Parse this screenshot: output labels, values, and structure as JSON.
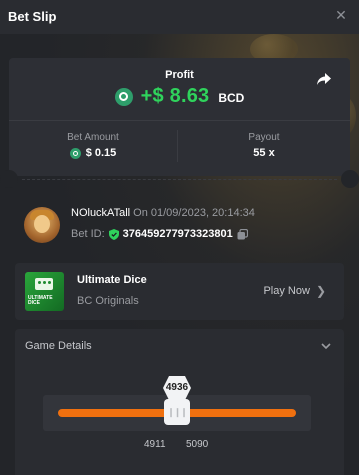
{
  "header": {
    "title": "Bet Slip",
    "close_icon": "close-icon"
  },
  "profit": {
    "label": "Profit",
    "value": "+$ 8.63",
    "currency": "BCD",
    "value_color": "#2fd35c"
  },
  "bet_amount": {
    "label": "Bet Amount",
    "value": "$ 0.15"
  },
  "payout": {
    "label": "Payout",
    "value": "55 x"
  },
  "user": {
    "name": "NOluckATall",
    "on_text": "On 01/09/2023, 20:14:34",
    "bet_id_label": "Bet ID:",
    "bet_id": "376459277973323801"
  },
  "game": {
    "thumb_text": "ULTIMATE DICE",
    "name": "Ultimate Dice",
    "provider": "BC Originals",
    "play_label": "Play Now"
  },
  "details": {
    "title": "Game Details",
    "result": "4936",
    "range_low": "4911",
    "range_high": "5090",
    "accent": "#f0700f"
  }
}
